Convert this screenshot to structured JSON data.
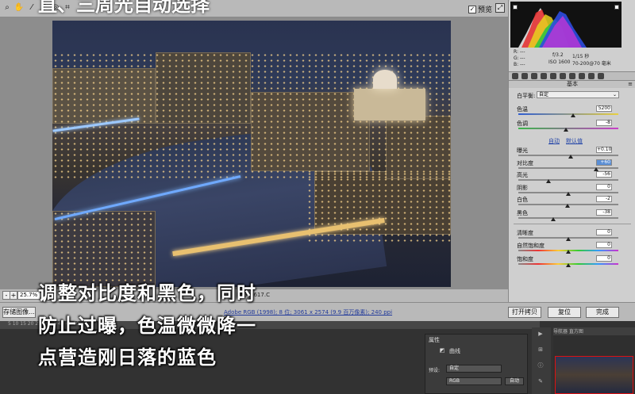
{
  "top_caption": "直、三周光自动选择",
  "toolbar": {
    "tools": [
      "zoom-icon",
      "hand-icon",
      "white-balance-icon",
      "color-sampler-icon",
      "target-adjust-icon",
      "crop-icon",
      "straighten-icon",
      "spot-removal-icon",
      "red-eye-icon",
      "adjustment-brush-icon",
      "graduated-filter-icon",
      "radial-filter-icon",
      "preferences-icon",
      "rotate-ccw-icon",
      "rotate-cw-icon"
    ],
    "preview_label": "预览",
    "preview_checked": "✓"
  },
  "zoom": {
    "value": "25.7%",
    "minus": "-",
    "plus": "+"
  },
  "filename": "IMG_0617.C",
  "workflow_link": "Adobe RGB (1998); 8 位; 3061 x 2574 (9.9 百万像素); 240 ppi",
  "buttons": {
    "save": "存储图像...",
    "open": "打开拷贝",
    "reset": "复位",
    "done": "完成"
  },
  "histogram_info": {
    "r": "R:",
    "g": "G:",
    "b": "B:",
    "dash": "---",
    "aperture": "f/3.2",
    "shutter": "1/15 秒",
    "iso": "ISO 1600",
    "lens": "70-200@70 毫米"
  },
  "panel": {
    "section": "基本",
    "section_menu": "≡",
    "white_balance_label": "白平衡:",
    "white_balance_value": "自定",
    "auto": "自动",
    "default": "默认值",
    "sliders": [
      {
        "label": "色温",
        "value": "5200"
      },
      {
        "label": "色调",
        "value": "-8"
      },
      {
        "label": "曝光",
        "value": "+0.10"
      },
      {
        "label": "对比度",
        "value": "+60"
      },
      {
        "label": "高光",
        "value": "-56"
      },
      {
        "label": "阴影",
        "value": "0"
      },
      {
        "label": "白色",
        "value": "-2"
      },
      {
        "label": "黑色",
        "value": "-38"
      },
      {
        "label": "清晰度",
        "value": "0"
      },
      {
        "label": "自然饱和度",
        "value": "0"
      },
      {
        "label": "饱和度",
        "value": "0"
      }
    ]
  },
  "caption_lines": [
    "调整对比度和黑色，同时",
    "防止过曝，色温微微降一",
    "点营造刚日落的蓝色"
  ],
  "photoshop": {
    "ruler": "5 10 15 20 25 30 35 40 45 50",
    "properties_title": "属性",
    "curves_label": "曲线",
    "preset_label": "预设:",
    "preset_value": "自定",
    "channel_value": "RGB",
    "auto_button": "自动",
    "nav_tabs": "导航器  直方图"
  }
}
